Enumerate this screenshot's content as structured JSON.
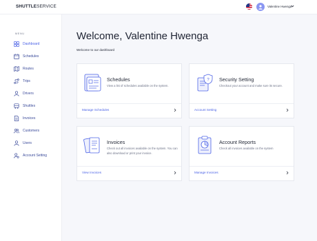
{
  "header": {
    "logo_bold": "SHUTTLE",
    "logo_light": "SERVICE",
    "flag_icon": "us-flag-icon",
    "user_name": "Valentine Hwenga"
  },
  "sidebar": {
    "menu_title": "MENU",
    "items": [
      {
        "label": "Dashboard",
        "icon": "dashboard-icon",
        "active": true
      },
      {
        "label": "Schedules",
        "icon": "calendar-icon",
        "active": false
      },
      {
        "label": "Routes",
        "icon": "map-icon",
        "active": false
      },
      {
        "label": "Trips",
        "icon": "route-icon",
        "active": false
      },
      {
        "label": "Drivers",
        "icon": "driver-icon",
        "active": false
      },
      {
        "label": "Shuttles",
        "icon": "bus-icon",
        "active": false
      },
      {
        "label": "Invoices",
        "icon": "invoice-icon",
        "active": false
      },
      {
        "label": "Customers",
        "icon": "customers-icon",
        "active": false
      },
      {
        "label": "Users",
        "icon": "user-icon",
        "active": false
      },
      {
        "label": "Account Setting",
        "icon": "account-setting-icon",
        "active": false
      }
    ]
  },
  "main": {
    "title": "Welcome, Valentine Hwenga",
    "subtitle": "Welcome to our dashboard"
  },
  "cards": [
    {
      "title": "Schedules",
      "description": "View a list of schedules available on the system.",
      "link": "Manage Schedules",
      "icon": "schedule-illustration-icon"
    },
    {
      "title": "Security Setting",
      "description": "Checkout your account and make sure its secure.",
      "link": "Account Setting",
      "icon": "security-illustration-icon"
    },
    {
      "title": "Invoices",
      "description": "Check out all invoices available on the system. You can also download or print your invoice.",
      "link": "View Invoices",
      "icon": "invoice-illustration-icon"
    },
    {
      "title": "Account Reports",
      "description": "Check all invoices available on the system",
      "link": "Manage Invoices",
      "icon": "report-illustration-icon"
    }
  ],
  "colors": {
    "accent": "#4b62e6",
    "nav_text": "#3a4a9a",
    "avatar": "#8a96f2",
    "background": "#f6f7fb"
  }
}
